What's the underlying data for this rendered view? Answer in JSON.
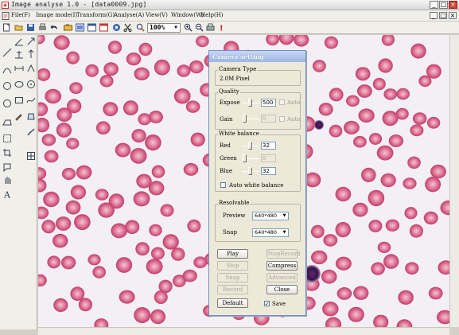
{
  "window": {
    "title": "Image analyse 1.0 - [data0009.jpg]",
    "controls": [
      "_",
      "□",
      "×"
    ]
  },
  "menu": {
    "items": [
      "File(F)",
      "Image mode(I)",
      "Transform(G)",
      "Analyse(A)",
      "View(V)",
      "Window(W)",
      "Help(H)"
    ],
    "right_controls": [
      "_",
      "□",
      "×"
    ]
  },
  "toolbar": {
    "zoom_value": "100%",
    "icons": [
      "new-icon",
      "open-icon",
      "save-icon",
      "print-setup-icon",
      "undo-icon",
      "camera-icon",
      "capture-icon",
      "video-icon",
      "record-icon",
      "settings-icon",
      "cut-icon",
      "zoom-icon",
      "zoom-in-icon",
      "zoom-out-icon",
      "printer-icon",
      "help-icon"
    ]
  },
  "left_tools": [
    "line-icon",
    "angle-icon",
    "arrow-icon",
    "scale-icon",
    "polyline-icon",
    "curve-icon",
    "circle-icon",
    "ellipse-icon",
    "point-icon",
    "polygon-icon",
    "rectangle-icon",
    "freehand-icon",
    "text-icon",
    "measure-icon",
    "count-icon",
    "eraser-icon"
  ],
  "dialog": {
    "title": "Camera setting",
    "camera_type": {
      "label": "Camera Type",
      "value": "2.0M Pixel"
    },
    "quality": {
      "label": "Quality",
      "expose_label": "Expose",
      "expose_value": "500",
      "expose_auto": "Auto",
      "gain_label": "Gain",
      "gain_value": "0",
      "gain_auto": "Auto"
    },
    "white_balance": {
      "label": "White balance",
      "red_label": "Red",
      "red_value": "32",
      "green_label": "Green",
      "green_value": "0",
      "blue_label": "Blue",
      "blue_value": "32",
      "auto_label": "Auto white balance"
    },
    "resolvable": {
      "label": "Resolvable",
      "preview_label": "Preview",
      "preview_value": "640*480",
      "snap_label": "Snap",
      "snap_value": "640*480"
    },
    "buttons": {
      "play": "Play",
      "stop_record": "StopRecord",
      "stop": "Stop",
      "compress": "Compress",
      "snap": "Snap",
      "advanced": "Advanced",
      "record": "Record",
      "close": "Close",
      "default": "Default"
    },
    "save": {
      "label": "Save",
      "checked": true
    }
  }
}
